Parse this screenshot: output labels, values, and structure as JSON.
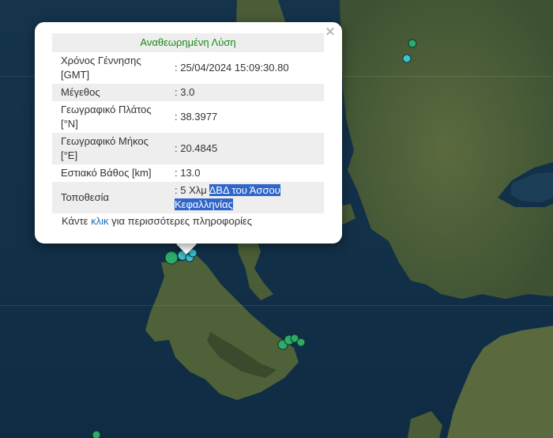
{
  "popup": {
    "title": "Αναθεωρημένη Λύση",
    "close_label": "×",
    "rows": [
      {
        "label": "Χρόνος Γέννησης [GMT]",
        "value": ": 25/04/2024 15:09:30.80"
      },
      {
        "label": "Μέγεθος",
        "value": ": 3.0"
      },
      {
        "label": "Γεωγραφικό Πλάτος [°N]",
        "value": ": 38.3977"
      },
      {
        "label": "Γεωγραφικό Μήκος [°E]",
        "value": ": 20.4845"
      },
      {
        "label": "Εστιακό Βάθος [km]",
        "value": ": 13.0"
      },
      {
        "label": "Τοποθεσία",
        "value_prefix": ": 5 Χλμ ",
        "value_highlight_1": "ΔΒΔ του Άσσου",
        "value_highlight_2": "Κεφαλληνίας"
      }
    ],
    "more": {
      "prefix": "Κάντε ",
      "link": "κλικ",
      "suffix": " για περισσότερες πληροφορίες"
    }
  },
  "colors": {
    "sea": "#12314a",
    "land": "#4d6038",
    "marker_green": "#2eaa6a",
    "marker_cyan": "#3ec2cf",
    "title_green": "#1a8a1a",
    "highlight": "#2f66c9"
  }
}
